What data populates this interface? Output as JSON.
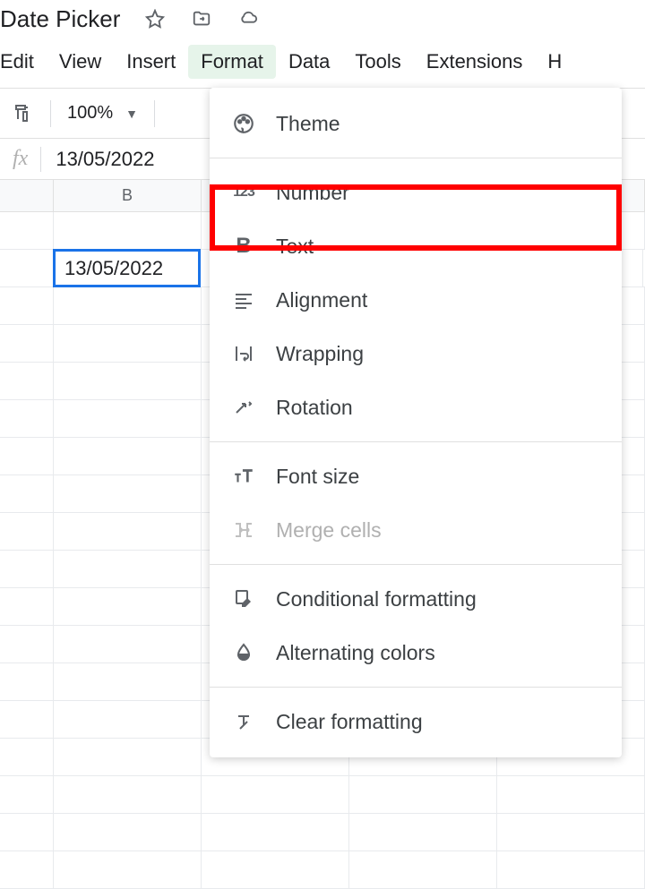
{
  "title": "Date Picker",
  "menu": {
    "edit": "Edit",
    "view": "View",
    "insert": "Insert",
    "format": "Format",
    "data": "Data",
    "tools": "Tools",
    "extensions": "Extensions",
    "help": "H"
  },
  "toolbar": {
    "zoom": "100%"
  },
  "formula": {
    "fx": "fx",
    "value": "13/05/2022"
  },
  "columns": {
    "b": "B"
  },
  "cells": {
    "b2": "13/05/2022"
  },
  "format_menu": {
    "theme": "Theme",
    "number": "Number",
    "text": "Text",
    "alignment": "Alignment",
    "wrapping": "Wrapping",
    "rotation": "Rotation",
    "fontsize": "Font size",
    "mergecells": "Merge cells",
    "conditional": "Conditional formatting",
    "alternating": "Alternating colors",
    "clear": "Clear formatting"
  }
}
